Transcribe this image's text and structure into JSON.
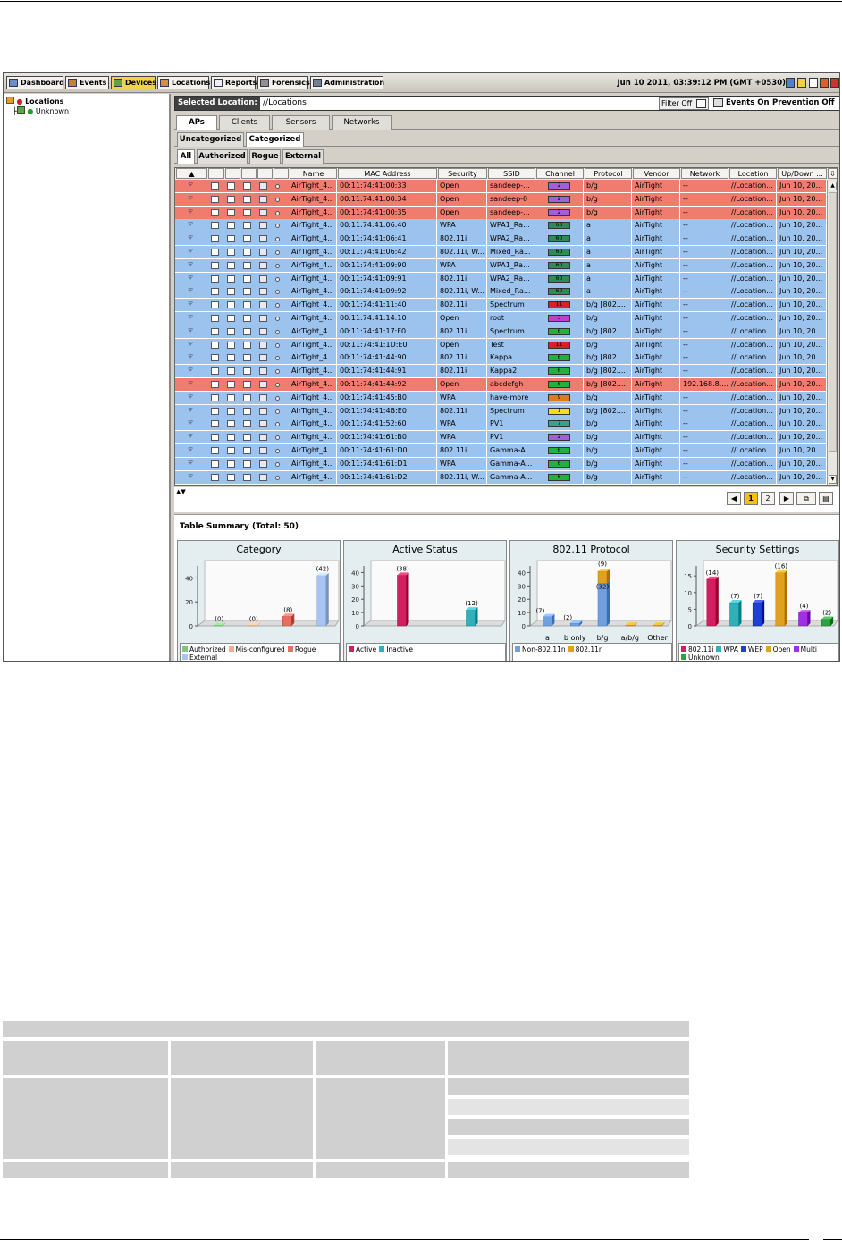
{
  "toolbar": {
    "buttons": [
      "Dashboard",
      "Events",
      "Devices",
      "Locations",
      "Reports",
      "Forensics",
      "Administration"
    ],
    "active": "Devices",
    "datetime": "Jun 10 2011, 03:39:12 PM (GMT +0530)"
  },
  "tree": {
    "root": "Locations",
    "child": "Unknown"
  },
  "selection": {
    "label": "Selected Location:",
    "path": "//Locations",
    "filter": "Filter Off",
    "events": "Events On",
    "prevention": "Prevention Off"
  },
  "tabs": {
    "main": [
      "APs",
      "Clients",
      "Sensors",
      "Networks"
    ],
    "sub": [
      "Uncategorized",
      "Categorized"
    ],
    "filter": [
      "All",
      "Authorized",
      "Rogue",
      "External"
    ]
  },
  "columns": [
    "Name",
    "MAC Address",
    "Security",
    "SSID",
    "Channel",
    "Protocol",
    "Vendor",
    "Network",
    "Location",
    "Up/Down ..."
  ],
  "rows": [
    {
      "status": "red",
      "name": "AirTight_4...",
      "mac": "00:11:74:41:00:33",
      "security": "Open",
      "ssid": "sandeep-...",
      "channel": "2",
      "chcolor": "#a060d8",
      "protocol": "b/g",
      "vendor": "AirTight",
      "network": "--",
      "location": "//Location...",
      "updown": "Jun 10, 20..."
    },
    {
      "status": "red",
      "name": "AirTight_4...",
      "mac": "00:11:74:41:00:34",
      "security": "Open",
      "ssid": "sandeep-0",
      "channel": "2",
      "chcolor": "#a060d8",
      "protocol": "b/g",
      "vendor": "AirTight",
      "network": "--",
      "location": "//Location...",
      "updown": "Jun 10, 20..."
    },
    {
      "status": "red",
      "name": "AirTight_4...",
      "mac": "00:11:74:41:00:35",
      "security": "Open",
      "ssid": "sandeep-...",
      "channel": "2",
      "chcolor": "#a060d8",
      "protocol": "b/g",
      "vendor": "AirTight",
      "network": "--",
      "location": "//Location...",
      "updown": "Jun 10, 20..."
    },
    {
      "status": "blue",
      "name": "AirTight_4...",
      "mac": "00:11:74:41:06:40",
      "security": "WPA",
      "ssid": "WPA1_Ra...",
      "channel": "60",
      "chcolor": "#2e8a58",
      "protocol": "a",
      "vendor": "AirTight",
      "network": "--",
      "location": "//Location...",
      "updown": "Jun 10, 20..."
    },
    {
      "status": "blue",
      "name": "AirTight_4...",
      "mac": "00:11:74:41:06:41",
      "security": "802.11i",
      "ssid": "WPA2_Ra...",
      "channel": "60",
      "chcolor": "#2e8a58",
      "protocol": "a",
      "vendor": "AirTight",
      "network": "--",
      "location": "//Location...",
      "updown": "Jun 10, 20..."
    },
    {
      "status": "blue",
      "name": "AirTight_4...",
      "mac": "00:11:74:41:06:42",
      "security": "802.11i, W...",
      "ssid": "Mixed_Ra...",
      "channel": "60",
      "chcolor": "#2e8a58",
      "protocol": "a",
      "vendor": "AirTight",
      "network": "--",
      "location": "//Location...",
      "updown": "Jun 10, 20..."
    },
    {
      "status": "blue",
      "name": "AirTight_4...",
      "mac": "00:11:74:41:09:90",
      "security": "WPA",
      "ssid": "WPA1_Ra...",
      "channel": "60",
      "chcolor": "#2e8a58",
      "protocol": "a",
      "vendor": "AirTight",
      "network": "--",
      "location": "//Location...",
      "updown": "Jun 10, 20..."
    },
    {
      "status": "blue",
      "name": "AirTight_4...",
      "mac": "00:11:74:41:09:91",
      "security": "802.11i",
      "ssid": "WPA2_Ra...",
      "channel": "60",
      "chcolor": "#2e8a58",
      "protocol": "a",
      "vendor": "AirTight",
      "network": "--",
      "location": "//Location...",
      "updown": "Jun 10, 20..."
    },
    {
      "status": "blue",
      "name": "AirTight_4...",
      "mac": "00:11:74:41:09:92",
      "security": "802.11i, W...",
      "ssid": "Mixed_Ra...",
      "channel": "60",
      "chcolor": "#2e8a58",
      "protocol": "a",
      "vendor": "AirTight",
      "network": "--",
      "location": "//Location...",
      "updown": "Jun 10, 20..."
    },
    {
      "status": "blue",
      "name": "AirTight_4...",
      "mac": "00:11:74:41:11:40",
      "security": "802.11i",
      "ssid": "Spectrum",
      "channel": "11",
      "chcolor": "#d8202a",
      "protocol": "b/g [802....",
      "vendor": "AirTight",
      "network": "--",
      "location": "//Location...",
      "updown": "Jun 10, 20..."
    },
    {
      "status": "blue",
      "name": "AirTight_4...",
      "mac": "00:11:74:41:14:10",
      "security": "Open",
      "ssid": "root",
      "channel": "3",
      "chcolor": "#c040c8",
      "protocol": "b/g",
      "vendor": "AirTight",
      "network": "--",
      "location": "//Location...",
      "updown": "Jun 10, 20..."
    },
    {
      "status": "blue",
      "name": "AirTight_4...",
      "mac": "00:11:74:41:17:F0",
      "security": "802.11i",
      "ssid": "Spectrum",
      "channel": "6",
      "chcolor": "#22b040",
      "protocol": "b/g [802....",
      "vendor": "AirTight",
      "network": "--",
      "location": "//Location...",
      "updown": "Jun 10, 20..."
    },
    {
      "status": "blue",
      "name": "AirTight_4...",
      "mac": "00:11:74:41:1D:E0",
      "security": "Open",
      "ssid": "Test",
      "channel": "11",
      "chcolor": "#d8202a",
      "protocol": "b/g",
      "vendor": "AirTight",
      "network": "--",
      "location": "//Location...",
      "updown": "Jun 10, 20..."
    },
    {
      "status": "blue",
      "name": "AirTight_4...",
      "mac": "00:11:74:41:44:90",
      "security": "802.11i",
      "ssid": "Kappa",
      "channel": "6",
      "chcolor": "#22b040",
      "protocol": "b/g [802....",
      "vendor": "AirTight",
      "network": "--",
      "location": "//Location...",
      "updown": "Jun 10, 20..."
    },
    {
      "status": "blue",
      "name": "AirTight_4...",
      "mac": "00:11:74:41:44:91",
      "security": "802.11i",
      "ssid": "Kappa2",
      "channel": "6",
      "chcolor": "#22b040",
      "protocol": "b/g [802....",
      "vendor": "AirTight",
      "network": "--",
      "location": "//Location...",
      "updown": "Jun 10, 20..."
    },
    {
      "status": "red",
      "name": "AirTight_4...",
      "mac": "00:11:74:41:44:92",
      "security": "Open",
      "ssid": "abcdefgh",
      "channel": "6",
      "chcolor": "#22b040",
      "protocol": "b/g [802....",
      "vendor": "AirTight",
      "network": "192.168.8....",
      "location": "//Location...",
      "updown": "Jun 10, 20..."
    },
    {
      "status": "blue",
      "name": "AirTight_4...",
      "mac": "00:11:74:41:45:B0",
      "security": "WPA",
      "ssid": "have-more",
      "channel": "9",
      "chcolor": "#e07a1a",
      "protocol": "b/g",
      "vendor": "AirTight",
      "network": "--",
      "location": "//Location...",
      "updown": "Jun 10, 20..."
    },
    {
      "status": "blue",
      "name": "AirTight_4...",
      "mac": "00:11:74:41:4B:E0",
      "security": "802.11i",
      "ssid": "Spectrum",
      "channel": "1",
      "chcolor": "#f0e020",
      "protocol": "b/g [802....",
      "vendor": "AirTight",
      "network": "--",
      "location": "//Location...",
      "updown": "Jun 10, 20..."
    },
    {
      "status": "blue",
      "name": "AirTight_4...",
      "mac": "00:11:74:41:52:60",
      "security": "WPA",
      "ssid": "PV1",
      "channel": "7",
      "chcolor": "#3aa090",
      "protocol": "b/g",
      "vendor": "AirTight",
      "network": "--",
      "location": "//Location...",
      "updown": "Jun 10, 20..."
    },
    {
      "status": "blue",
      "name": "AirTight_4...",
      "mac": "00:11:74:41:61:B0",
      "security": "WPA",
      "ssid": "PV1",
      "channel": "2",
      "chcolor": "#a060d8",
      "protocol": "b/g",
      "vendor": "AirTight",
      "network": "--",
      "location": "//Location...",
      "updown": "Jun 10, 20..."
    },
    {
      "status": "blue",
      "name": "AirTight_4...",
      "mac": "00:11:74:41:61:D0",
      "security": "802.11i",
      "ssid": "Gamma-A...",
      "channel": "6",
      "chcolor": "#22b040",
      "protocol": "b/g",
      "vendor": "AirTight",
      "network": "--",
      "location": "//Location...",
      "updown": "Jun 10, 20..."
    },
    {
      "status": "blue",
      "name": "AirTight_4...",
      "mac": "00:11:74:41:61:D1",
      "security": "WPA",
      "ssid": "Gamma-A...",
      "channel": "6",
      "chcolor": "#22b040",
      "protocol": "b/g",
      "vendor": "AirTight",
      "network": "--",
      "location": "//Location...",
      "updown": "Jun 10, 20..."
    },
    {
      "status": "blue",
      "name": "AirTight_4...",
      "mac": "00:11:74:41:61:D2",
      "security": "802.11i, W...",
      "ssid": "Gamma-A...",
      "channel": "6",
      "chcolor": "#22b040",
      "protocol": "b/g",
      "vendor": "AirTight",
      "network": "--",
      "location": "//Location...",
      "updown": "Jun 10, 20..."
    }
  ],
  "pager": {
    "pages": [
      "1",
      "2"
    ],
    "current": "1"
  },
  "summary": {
    "title": "Table Summary (Total: 50)"
  },
  "chart_data": [
    {
      "type": "bar",
      "title": "Category",
      "categories": [
        "Authorized",
        "Mis-configured",
        "Rogue",
        "External"
      ],
      "values": [
        0,
        0,
        8,
        42
      ],
      "colors": [
        "#7ac878",
        "#f0b090",
        "#e07060",
        "#a8c4f0"
      ],
      "ylim": [
        0,
        50
      ],
      "yticks": [
        0,
        20,
        40
      ],
      "legend": [
        "Authorized",
        "Mis-configured",
        "Rogue",
        "External"
      ]
    },
    {
      "type": "bar",
      "title": "Active Status",
      "categories": [
        "Active",
        "Inactive"
      ],
      "values": [
        38,
        12
      ],
      "colors": [
        "#d02060",
        "#30b0b8"
      ],
      "ylim": [
        0,
        45
      ],
      "yticks": [
        0,
        10,
        20,
        30,
        40
      ],
      "legend": [
        "Active",
        "Inactive"
      ]
    },
    {
      "type": "bar",
      "title": "802.11 Protocol",
      "categories": [
        "a",
        "b only",
        "b/g",
        "a/b/g",
        "Other"
      ],
      "series": [
        {
          "name": "Non-802.11n",
          "values": [
            7,
            2,
            32,
            0,
            0
          ],
          "color": "#70a0e0"
        },
        {
          "name": "802.11n",
          "values": [
            0,
            0,
            9,
            0,
            0
          ],
          "color": "#e0a020"
        }
      ],
      "ylim": [
        0,
        45
      ],
      "yticks": [
        0,
        10,
        20,
        30,
        40
      ],
      "labels": [
        "(7)",
        "(2)",
        "(32)",
        "(9)"
      ]
    },
    {
      "type": "bar",
      "title": "Security Settings",
      "categories": [
        "802.11i",
        "WPA",
        "WEP",
        "Open",
        "Multi",
        "Unknown"
      ],
      "values": [
        14,
        7,
        7,
        16,
        4,
        2
      ],
      "colors": [
        "#d02060",
        "#30b0b8",
        "#2040d0",
        "#e0a020",
        "#a030e0",
        "#30a040"
      ],
      "ylim": [
        0,
        18
      ],
      "yticks": [
        0,
        5,
        10,
        15
      ],
      "legend": [
        "802.11i",
        "WPA",
        "WEP",
        "Open",
        "Multi",
        "Unknown"
      ]
    }
  ]
}
